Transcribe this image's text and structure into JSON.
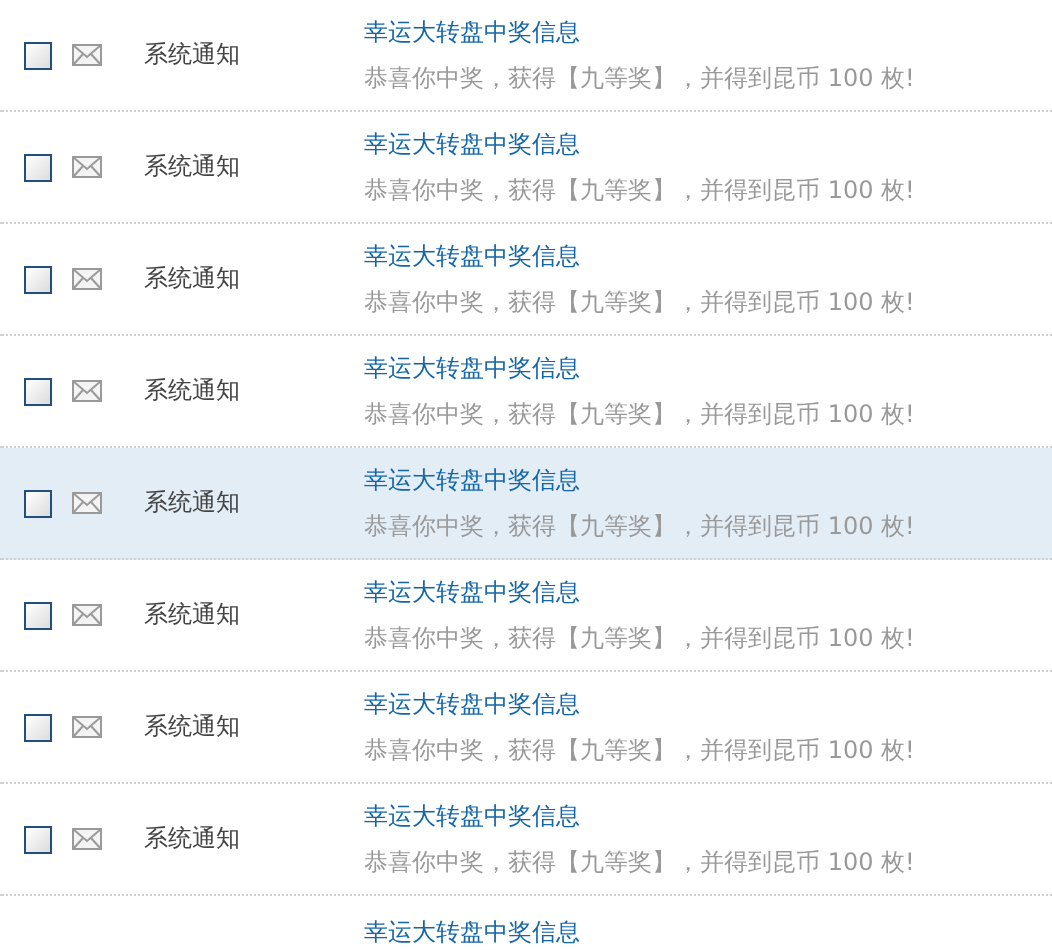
{
  "messages": [
    {
      "checked": false,
      "highlighted": false,
      "sender": "系统通知",
      "title": "幸运大转盘中奖信息",
      "body": "恭喜你中奖，获得【九等奖】，并得到昆币 100 枚!"
    },
    {
      "checked": false,
      "highlighted": false,
      "sender": "系统通知",
      "title": "幸运大转盘中奖信息",
      "body": "恭喜你中奖，获得【九等奖】，并得到昆币 100 枚!"
    },
    {
      "checked": false,
      "highlighted": false,
      "sender": "系统通知",
      "title": "幸运大转盘中奖信息",
      "body": "恭喜你中奖，获得【九等奖】，并得到昆币 100 枚!"
    },
    {
      "checked": false,
      "highlighted": false,
      "sender": "系统通知",
      "title": "幸运大转盘中奖信息",
      "body": "恭喜你中奖，获得【九等奖】，并得到昆币 100 枚!"
    },
    {
      "checked": false,
      "highlighted": true,
      "sender": "系统通知",
      "title": "幸运大转盘中奖信息",
      "body": "恭喜你中奖，获得【九等奖】，并得到昆币 100 枚!"
    },
    {
      "checked": false,
      "highlighted": false,
      "sender": "系统通知",
      "title": "幸运大转盘中奖信息",
      "body": "恭喜你中奖，获得【九等奖】，并得到昆币 100 枚!"
    },
    {
      "checked": false,
      "highlighted": false,
      "sender": "系统通知",
      "title": "幸运大转盘中奖信息",
      "body": "恭喜你中奖，获得【九等奖】，并得到昆币 100 枚!"
    },
    {
      "checked": false,
      "highlighted": false,
      "sender": "系统通知",
      "title": "幸运大转盘中奖信息",
      "body": "恭喜你中奖，获得【九等奖】，并得到昆币 100 枚!"
    }
  ],
  "partial_row": {
    "title": "幸运大转盘中奖信息"
  }
}
